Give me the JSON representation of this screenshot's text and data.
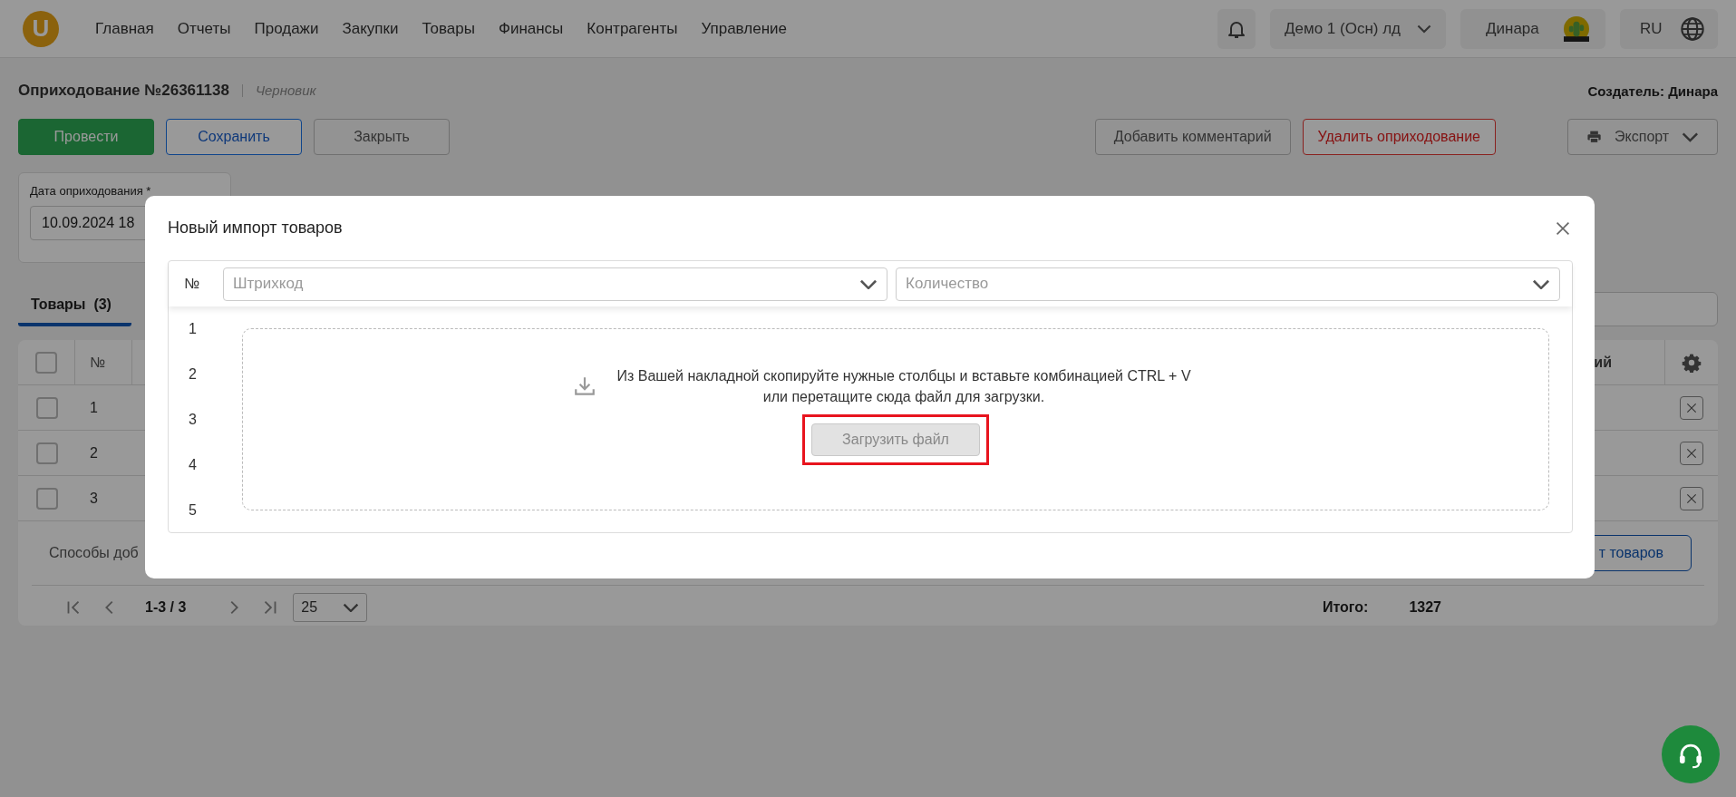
{
  "top_bar": {
    "logo_letter": "U",
    "nav": [
      {
        "label": "Главная"
      },
      {
        "label": "Отчеты"
      },
      {
        "label": "Продажи"
      },
      {
        "label": "Закупки"
      },
      {
        "label": "Товары"
      },
      {
        "label": "Финансы"
      },
      {
        "label": "Контрагенты"
      },
      {
        "label": "Управление"
      }
    ],
    "company": "Демо 1 (Осн) лд",
    "user": "Динара",
    "language": "RU"
  },
  "document": {
    "title": "Оприходование №26361138",
    "status": "Черновик",
    "creator": "Создатель: Динара"
  },
  "actions_left": [
    {
      "label": "Провести",
      "kind": "primary"
    },
    {
      "label": "Сохранить",
      "kind": "outline"
    },
    {
      "label": "Закрыть",
      "kind": "default"
    }
  ],
  "actions_right": [
    {
      "label": "Добавить комментарий",
      "kind": "default"
    },
    {
      "label": "Удалить оприходование",
      "kind": "danger"
    },
    {
      "label": "Экспорт",
      "kind": "menu"
    }
  ],
  "date_field": {
    "label": "Дата оприходования *",
    "value": "10.09.2024 18"
  },
  "tabs": [
    {
      "label": "Товары",
      "count": "(3)",
      "selected": true
    }
  ],
  "table": {
    "header_checked": false,
    "columns": [
      "№",
      "ий"
    ],
    "rows": [
      {
        "number": "1",
        "checked": false
      },
      {
        "number": "2",
        "checked": false
      },
      {
        "number": "3",
        "checked": false
      }
    ],
    "footer_text": "Способы доб",
    "footer_button": "т товаров"
  },
  "pagination": {
    "range": "1-3 / 3",
    "page_size": "25",
    "total_label": "Итого:",
    "total_value": "1327"
  },
  "modal": {
    "title": "Новый импорт товаров",
    "number_header": "№",
    "column_selects": [
      {
        "placeholder": "Штрихкод"
      },
      {
        "placeholder": "Количество"
      }
    ],
    "row_numbers": [
      "1",
      "2",
      "3",
      "4",
      "5"
    ],
    "dropzone": {
      "lines": [
        "Из Вашей накладной скопируйте нужные столбцы и вставьте комбинацией CTRL + V",
        "или перетащите сюда файл для загрузки."
      ],
      "button": {
        "label": "Загрузить файл",
        "highlighted": true
      }
    }
  }
}
